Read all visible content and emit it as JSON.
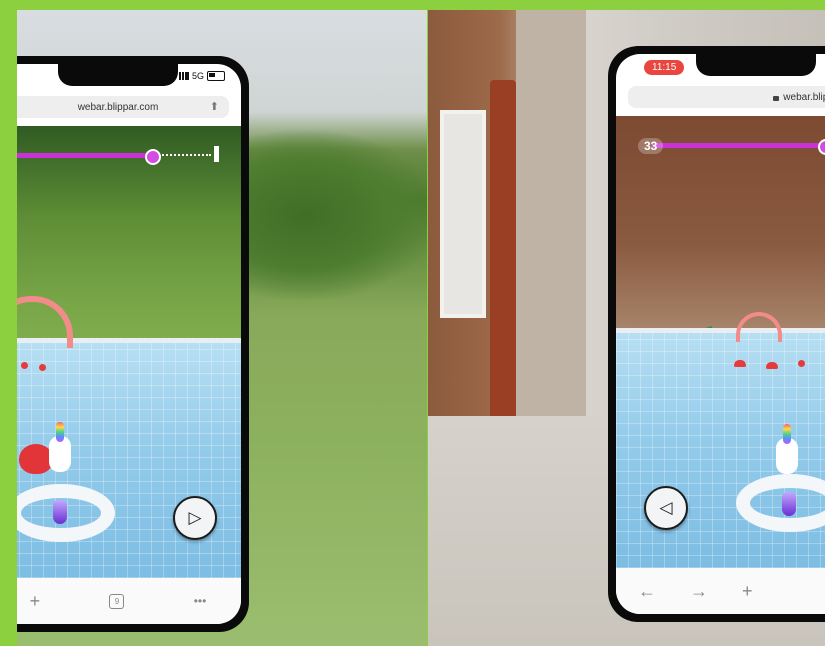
{
  "left_phone": {
    "status": {
      "network": "5G"
    },
    "url": "webar.blippar.com",
    "icons": {
      "share": "share-icon",
      "next": "play-right-icon"
    },
    "progress_fraction": 0.72,
    "toolbar": {
      "new_tab": "+",
      "tab_count": "9",
      "more": "•••"
    }
  },
  "right_phone": {
    "status": {
      "time": "11:15"
    },
    "url": "webar.blippar.c",
    "score": "33",
    "icons": {
      "back": "triangle-left-icon"
    },
    "progress_fraction": 0.78,
    "toolbar": {
      "back": "←",
      "forward": "→",
      "new_tab": "+"
    }
  },
  "colors": {
    "frame_border": "#8ccf3f",
    "progress": "#c832d8",
    "time_pill": "#e8463f"
  }
}
